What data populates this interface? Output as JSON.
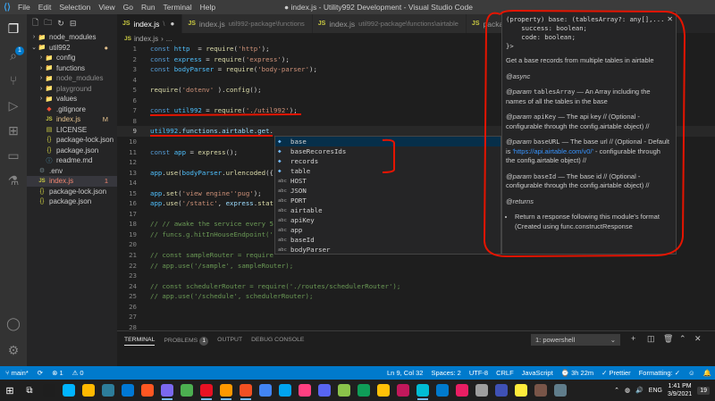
{
  "window": {
    "title": "● index.js - Utility992 Development - Visual Studio Code",
    "menu": [
      "File",
      "Edit",
      "Selection",
      "View",
      "Go",
      "Run",
      "Terminal",
      "Help"
    ]
  },
  "explorer": {
    "items": [
      {
        "label": "node_modules",
        "depth": 1,
        "type": "folder",
        "expanded": false,
        "state": "normal"
      },
      {
        "label": "util992",
        "depth": 1,
        "type": "folder",
        "expanded": true,
        "state": "normal",
        "dot": "●"
      },
      {
        "label": "config",
        "depth": 2,
        "type": "folder",
        "expanded": false,
        "state": "normal"
      },
      {
        "label": "functions",
        "depth": 2,
        "type": "folder",
        "expanded": false,
        "state": "normal"
      },
      {
        "label": "node_modules",
        "depth": 2,
        "type": "folder",
        "expanded": false,
        "state": "dim"
      },
      {
        "label": "playground",
        "depth": 2,
        "type": "folder",
        "expanded": false,
        "state": "dim"
      },
      {
        "label": "values",
        "depth": 2,
        "type": "folder",
        "expanded": false,
        "state": "normal"
      },
      {
        "label": ".gitignore",
        "depth": 2,
        "type": "git",
        "state": "normal"
      },
      {
        "label": "index.js",
        "depth": 2,
        "type": "js",
        "state": "mod",
        "badge": "M"
      },
      {
        "label": "LICENSE",
        "depth": 2,
        "type": "license",
        "state": "normal"
      },
      {
        "label": "package-lock.json",
        "depth": 2,
        "type": "json",
        "state": "normal"
      },
      {
        "label": "package.json",
        "depth": 2,
        "type": "json",
        "state": "normal"
      },
      {
        "label": "readme.md",
        "depth": 2,
        "type": "md",
        "state": "normal"
      },
      {
        "label": ".env",
        "depth": 1,
        "type": "env",
        "state": "normal"
      },
      {
        "label": "index.js",
        "depth": 1,
        "type": "js",
        "state": "err",
        "badge": "1",
        "selected": true
      },
      {
        "label": "package-lock.json",
        "depth": 1,
        "type": "json",
        "state": "normal"
      },
      {
        "label": "package.json",
        "depth": 1,
        "type": "json",
        "state": "normal"
      }
    ]
  },
  "tabs": [
    {
      "label": "index.js",
      "sub": "\\",
      "active": true,
      "close": "●"
    },
    {
      "label": "index.js",
      "sub": "util992-package\\functions",
      "active": false
    },
    {
      "label": "index.js",
      "sub": "util992-package\\functions\\airtable",
      "active": false
    },
    {
      "label": "package.j",
      "sub": "",
      "active": false
    }
  ],
  "breadcrumb": {
    "file": "index.js",
    "rest": "..."
  },
  "editor": {
    "lines": [
      {
        "n": "1",
        "tokens": [
          [
            "kw",
            "const "
          ],
          [
            "var",
            "http"
          ],
          [
            "",
            "  = "
          ],
          [
            "fn",
            "require"
          ],
          [
            "",
            "("
          ],
          [
            "str",
            "'http'"
          ],
          [
            "",
            ");"
          ]
        ]
      },
      {
        "n": "2",
        "tokens": [
          [
            "kw",
            "const "
          ],
          [
            "var",
            "express"
          ],
          [
            "",
            " = "
          ],
          [
            "fn",
            "require"
          ],
          [
            "",
            "("
          ],
          [
            "str",
            "'express'"
          ],
          [
            "",
            ");"
          ]
        ]
      },
      {
        "n": "3",
        "tokens": [
          [
            "kw",
            "const "
          ],
          [
            "var",
            "bodyParser"
          ],
          [
            "",
            " = "
          ],
          [
            "fn",
            "require"
          ],
          [
            "",
            "("
          ],
          [
            "str",
            "'body-parser'"
          ],
          [
            "",
            ");"
          ]
        ]
      },
      {
        "n": "4",
        "tokens": []
      },
      {
        "n": "5",
        "tokens": [
          [
            "fn",
            "require"
          ],
          [
            "",
            "("
          ],
          [
            "str",
            "'dotenv'"
          ],
          [
            "",
            " )."
          ],
          [
            "fn",
            "config"
          ],
          [
            "",
            "();"
          ]
        ]
      },
      {
        "n": "6",
        "tokens": []
      },
      {
        "n": "7",
        "tokens": [
          [
            "kw",
            "const "
          ],
          [
            "var",
            "util992"
          ],
          [
            "",
            " = "
          ],
          [
            "fn",
            "require"
          ],
          [
            "",
            "("
          ],
          [
            "str",
            "'./util992'"
          ],
          [
            "",
            ");"
          ]
        ]
      },
      {
        "n": "8",
        "tokens": []
      },
      {
        "n": "9",
        "tokens": [
          [
            "var",
            "util992"
          ],
          [
            "",
            "."
          ],
          [
            "id",
            "functions"
          ],
          [
            "",
            "."
          ],
          [
            "id",
            "airtable"
          ],
          [
            "",
            "."
          ],
          [
            "id",
            "get"
          ],
          [
            "",
            "."
          ]
        ],
        "current": true
      },
      {
        "n": "10",
        "tokens": []
      },
      {
        "n": "11",
        "tokens": [
          [
            "kw",
            "const "
          ],
          [
            "var",
            "app"
          ],
          [
            "",
            " = "
          ],
          [
            "fn",
            "express"
          ],
          [
            "",
            "();"
          ]
        ]
      },
      {
        "n": "12",
        "tokens": []
      },
      {
        "n": "13",
        "tokens": [
          [
            "var",
            "app"
          ],
          [
            "",
            "."
          ],
          [
            "fn",
            "use"
          ],
          [
            "",
            "("
          ],
          [
            "var",
            "bodyParser"
          ],
          [
            "",
            "."
          ],
          [
            "fn",
            "urlencoded"
          ],
          [
            "",
            "({"
          ]
        ]
      },
      {
        "n": "14",
        "tokens": []
      },
      {
        "n": "15",
        "tokens": [
          [
            "var",
            "app"
          ],
          [
            "",
            "."
          ],
          [
            "fn",
            "set"
          ],
          [
            "",
            "("
          ],
          [
            "str",
            "'view engine'"
          ],
          [
            ", "
          ],
          [
            "str",
            "'pug'"
          ],
          [
            "",
            ");"
          ]
        ]
      },
      {
        "n": "16",
        "tokens": [
          [
            "var",
            "app"
          ],
          [
            "",
            "."
          ],
          [
            "fn",
            "use"
          ],
          [
            "",
            "("
          ],
          [
            "str",
            "'/static'"
          ],
          [
            "",
            ", "
          ],
          [
            "id",
            "express"
          ],
          [
            "",
            "."
          ],
          [
            "fn",
            "stat"
          ]
        ]
      },
      {
        "n": "17",
        "tokens": []
      },
      {
        "n": "18",
        "tokens": [
          [
            "cm",
            "// // awake the service every 5"
          ]
        ]
      },
      {
        "n": "19",
        "tokens": [
          [
            "cm",
            "// funcs.g.hitInHouseEndpoint('"
          ]
        ]
      },
      {
        "n": "20",
        "tokens": []
      },
      {
        "n": "21",
        "tokens": [
          [
            "cm",
            "// const sampleRouter = require"
          ]
        ]
      },
      {
        "n": "22",
        "tokens": [
          [
            "cm",
            "// app.use('/sample', sampleRouter);"
          ]
        ]
      },
      {
        "n": "23",
        "tokens": []
      },
      {
        "n": "24",
        "tokens": [
          [
            "cm",
            "// const schedulerRouter = require('./routes/schedulerRouter');"
          ]
        ]
      },
      {
        "n": "25",
        "tokens": [
          [
            "cm",
            "// app.use('/schedule', schedulerRouter);"
          ]
        ]
      },
      {
        "n": "26",
        "tokens": []
      },
      {
        "n": "27",
        "tokens": []
      },
      {
        "n": "28",
        "tokens": []
      },
      {
        "n": "29",
        "tokens": [
          [
            "var",
            "app"
          ],
          [
            "",
            "."
          ],
          [
            "fn",
            "get"
          ],
          [
            "",
            "("
          ],
          [
            "str",
            "'/test'"
          ],
          [
            "",
            ", "
          ],
          [
            "kw",
            "function "
          ],
          [
            "",
            "("
          ],
          [
            "id",
            "req"
          ],
          [
            "",
            ", "
          ],
          [
            "id",
            "res"
          ],
          [
            "",
            ") {"
          ]
        ]
      }
    ]
  },
  "suggest": {
    "items": [
      {
        "kind": "prop",
        "label": "base",
        "selected": true
      },
      {
        "kind": "prop",
        "label": "baseRecoresIds"
      },
      {
        "kind": "prop",
        "label": "records"
      },
      {
        "kind": "prop",
        "label": "table"
      },
      {
        "kind": "abc",
        "label": "HOST"
      },
      {
        "kind": "abc",
        "label": "JSON"
      },
      {
        "kind": "abc",
        "label": "PORT"
      },
      {
        "kind": "abc",
        "label": "airtable"
      },
      {
        "kind": "abc",
        "label": "apiKey"
      },
      {
        "kind": "abc",
        "label": "app"
      },
      {
        "kind": "abc",
        "label": "baseId"
      },
      {
        "kind": "abc",
        "label": "bodyParser"
      }
    ],
    "kind_labels": {
      "prop": "◆",
      "abc": "abc"
    }
  },
  "detail": {
    "signature": "(property) base: (tablesArray?: any[],...\n    success: boolean;\n    code: boolean;\n}>",
    "description": "Get a base records from multiple tables in airtable",
    "async_tag": "@async",
    "params": [
      {
        "tag": "@param",
        "name": "tablesArray",
        "text": " — An Array including the names of all the tables in the base"
      },
      {
        "tag": "@param",
        "name": "apiKey",
        "text": " — The api key // (Optional - configurable through the config.airtable object) //"
      },
      {
        "tag": "@param",
        "name": "baseURL",
        "text": " — The base url // (Optional - Default is ",
        "link": "'https://api.airtable.com/v0/'",
        "text2": " - configurable through the config.airtable object) //"
      },
      {
        "tag": "@param",
        "name": "baseId",
        "text": " — The base id // (Optional - configurable through the config.airtable object) //"
      }
    ],
    "returns_tag": "@returns",
    "returns": "Return a response following this module's format (Created using func.constructResponse"
  },
  "panel": {
    "tabs": [
      {
        "label": "TERMINAL",
        "active": true
      },
      {
        "label": "PROBLEMS",
        "badge": "1"
      },
      {
        "label": "OUTPUT"
      },
      {
        "label": "DEBUG CONSOLE"
      }
    ],
    "terminal_select": "1: powershell"
  },
  "status": {
    "branch": "main*",
    "errors": "⊗ 1",
    "warnings": "⚠ 0",
    "position": "Ln 9, Col 32",
    "spaces": "Spaces: 2",
    "encoding": "UTF-8",
    "eol": "CRLF",
    "language": "JavaScript",
    "time": "⌚ 3h 22m",
    "prettier": "✓ Prettier",
    "formatting": "Formatting: ✓"
  },
  "taskbar": {
    "lang": "ENG",
    "time": "1:41 PM",
    "date": "3/9/2021",
    "notif": "19",
    "colors": [
      "#1e1e1e",
      "#00b4ff",
      "#ffb900",
      "#2d7d9a",
      "#0078d4",
      "#ff5722",
      "#7b68ee",
      "#4caf50",
      "#e81123",
      "#ff9800",
      "#f25022",
      "#4285f4",
      "#00a4ef",
      "#ff4081",
      "#5865f2",
      "#8bc34a",
      "#0f9d58",
      "#ffc107",
      "#c2185b",
      "#00bcd4",
      "#007acc",
      "#e91e63",
      "#9e9e9e",
      "#3f51b5",
      "#ffeb3b",
      "#795548",
      "#607d8b"
    ]
  }
}
